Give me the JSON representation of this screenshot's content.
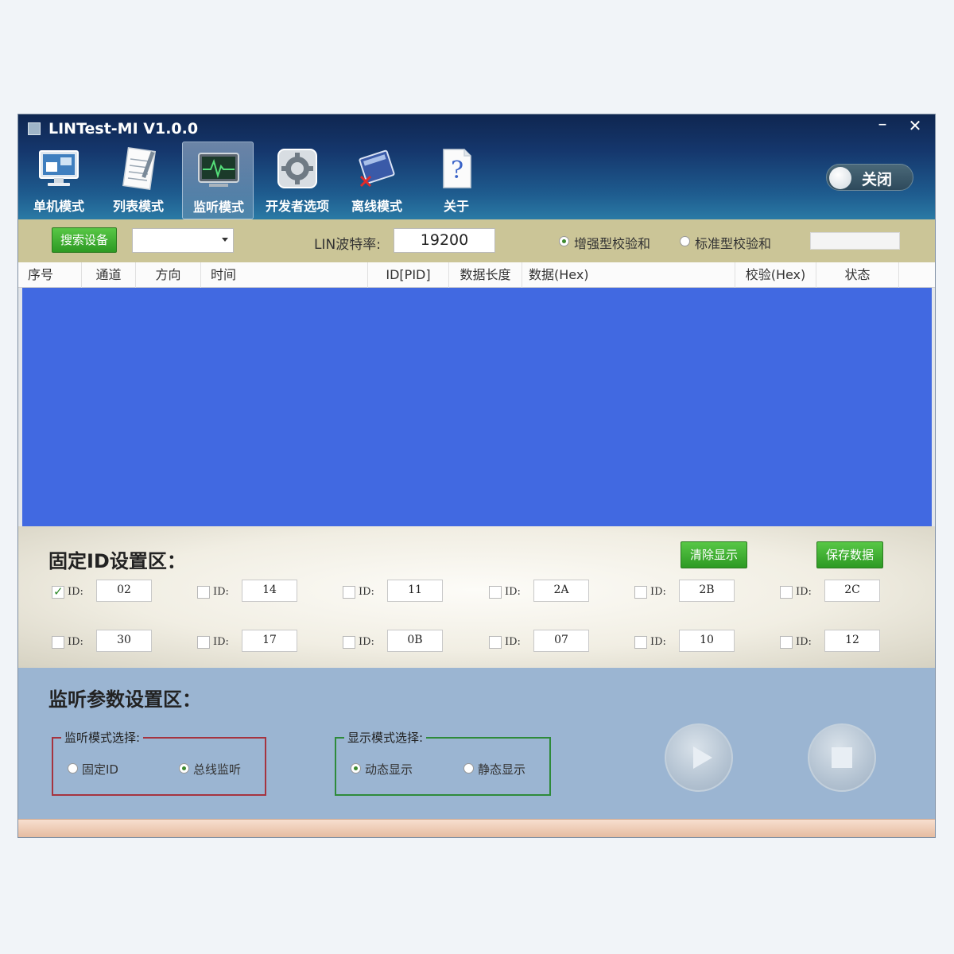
{
  "window": {
    "title": "LINTest-MI V1.0.0",
    "minimize_label": "–",
    "close_label": "✕"
  },
  "nav": {
    "items": [
      {
        "label": "单机模式",
        "icon": "monitor-icon"
      },
      {
        "label": "列表模式",
        "icon": "notebook-icon"
      },
      {
        "label": "监听模式",
        "icon": "waveform-monitor-icon",
        "active": true
      },
      {
        "label": "开发者选项",
        "icon": "gear-icon"
      },
      {
        "label": "离线模式",
        "icon": "offline-book-icon"
      },
      {
        "label": "关于",
        "icon": "help-icon"
      }
    ]
  },
  "toggle": {
    "label": "关闭"
  },
  "toolbar": {
    "search_label": "搜索设备",
    "device_value": "",
    "baud_label": "LIN波特率:",
    "baud_value": "19200",
    "checksum_enhanced": "增强型校验和",
    "checksum_standard": "标准型校验和"
  },
  "table": {
    "headers": [
      "序号",
      "通道",
      "方向",
      "时间",
      "ID[PID]",
      "数据长度",
      "数据(Hex)",
      "校验(Hex)",
      "状态"
    ]
  },
  "fixed_id": {
    "title": "固定ID设置区：",
    "clear_label": "清除显示",
    "save_label": "保存数据",
    "id_label": "ID:",
    "row1": [
      {
        "value": "02",
        "checked": true
      },
      {
        "value": "14",
        "checked": false
      },
      {
        "value": "11",
        "checked": false
      },
      {
        "value": "2A",
        "checked": false
      },
      {
        "value": "2B",
        "checked": false
      },
      {
        "value": "2C",
        "checked": false
      }
    ],
    "row2": [
      {
        "value": "30",
        "checked": false
      },
      {
        "value": "17",
        "checked": false
      },
      {
        "value": "0B",
        "checked": false
      },
      {
        "value": "07",
        "checked": false
      },
      {
        "value": "10",
        "checked": false
      },
      {
        "value": "12",
        "checked": false
      }
    ]
  },
  "monitor": {
    "title": "监听参数设置区：",
    "mode_group": {
      "label": "监听模式选择:",
      "opt1": "固定ID",
      "opt2": "总线监听",
      "selected": "opt2"
    },
    "display_group": {
      "label": "显示模式选择:",
      "opt1": "动态显示",
      "opt2": "静态显示",
      "selected": "opt1"
    }
  },
  "colors": {
    "table_body": "#4169e1",
    "toolbar": "#cbc597",
    "monitor_panel": "#9bb5d2",
    "mode_group_border": "#a5333f",
    "display_group_border": "#2e8a3a"
  }
}
